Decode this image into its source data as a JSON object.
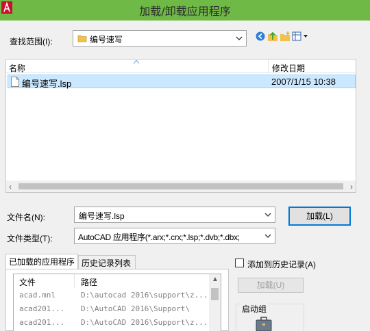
{
  "window": {
    "title": "加载/卸载应用程序"
  },
  "lookin": {
    "label": "查找范围(I):",
    "value": "编号速写"
  },
  "toolbar": {
    "icons": [
      "back-icon",
      "up-folder-icon",
      "new-folder-icon",
      "views-menu-icon"
    ]
  },
  "filelist": {
    "col_name": "名称",
    "col_modified": "修改日期",
    "rows": [
      {
        "name": "编号速写.lsp",
        "modified": "2007/1/15 10:38",
        "selected": true
      }
    ],
    "scroll_left": "‹",
    "scroll_right": "›"
  },
  "filename": {
    "label": "文件名(N):",
    "value": "编号速写.lsp"
  },
  "filetype": {
    "label": "文件类型(T):",
    "value": "AutoCAD 应用程序(*.arx;*.crx;*.lsp;*.dvb;*.dbx;"
  },
  "buttons": {
    "load": "加载(L)",
    "load_disabled": "加载(U)"
  },
  "tabs": [
    {
      "label": "已加载的应用程序",
      "active": true
    },
    {
      "label": "历史记录列表",
      "active": false
    }
  ],
  "loaded_list": {
    "col_file": "文件",
    "col_path": "路径",
    "rows": [
      {
        "file": "acad.mnl",
        "path": "D:\\autocad 2016\\support\\z..."
      },
      {
        "file": "acad201...",
        "path": "D:\\AutoCAD 2016\\Support\\"
      },
      {
        "file": "acad201...",
        "path": "D:\\AutoCAD 2016\\Support\\z..."
      }
    ]
  },
  "history": {
    "label": "添加到历史记录(A)",
    "checked": false
  },
  "startup": {
    "label": "启动组"
  },
  "colors": {
    "titlebar": "#6fb946",
    "selection": "#cce8ff",
    "accent": "#0078d7"
  }
}
